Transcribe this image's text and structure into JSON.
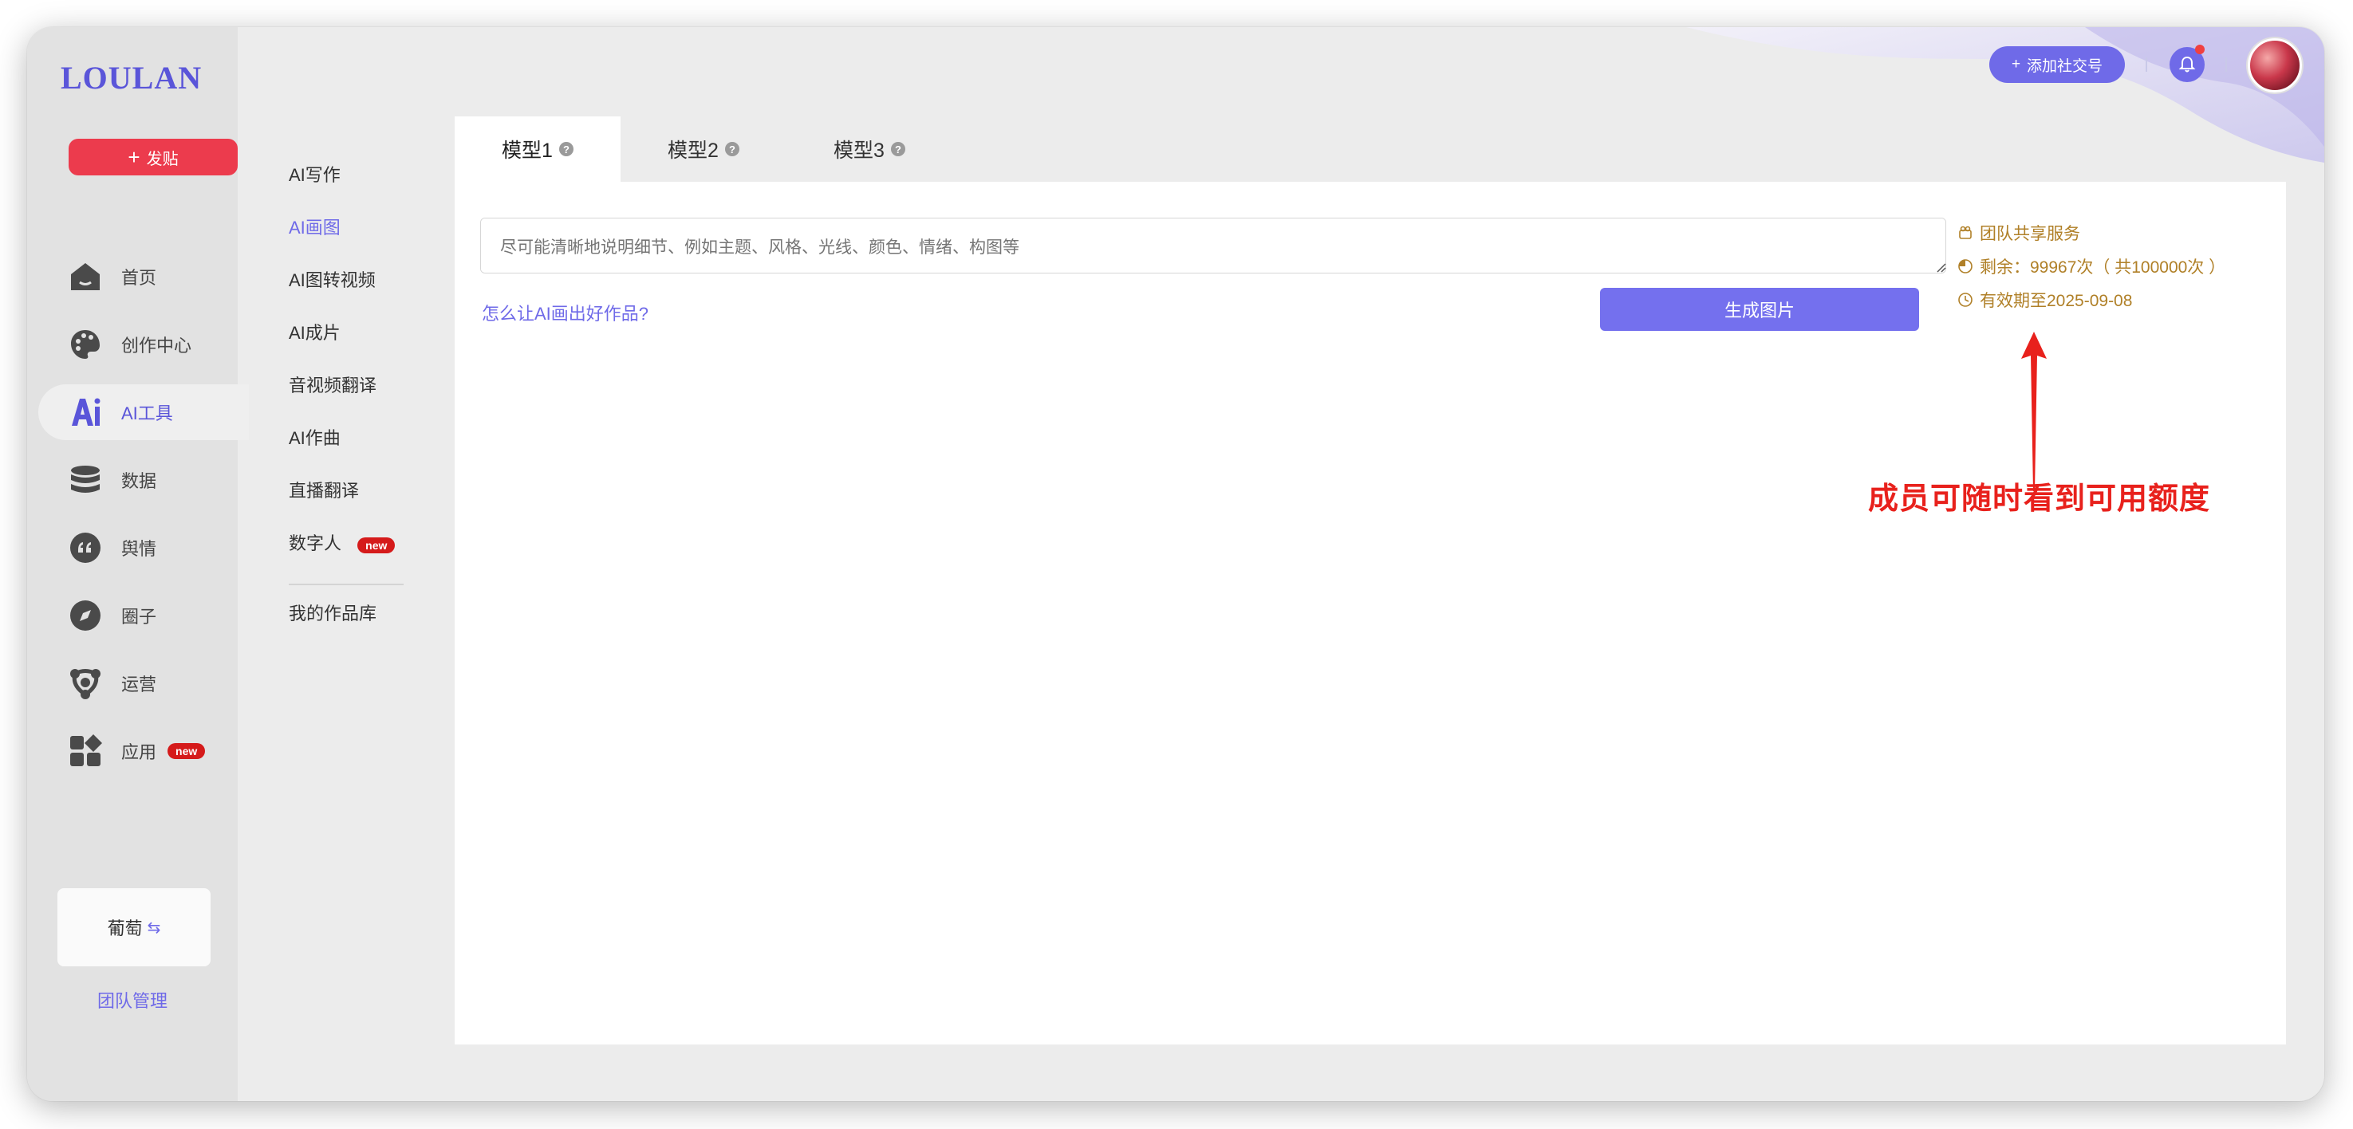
{
  "brand": {
    "logo": "LOULAN",
    "accent": "#6f6ae8",
    "post_color": "#ec3b4d"
  },
  "sidebar": {
    "post_button": "发贴",
    "items": [
      {
        "label": "首页",
        "icon": "home-icon",
        "active": false
      },
      {
        "label": "创作中心",
        "icon": "palette-icon",
        "active": false
      },
      {
        "label": "AI工具",
        "icon": "ai-icon",
        "active": true
      },
      {
        "label": "数据",
        "icon": "database-icon",
        "active": false
      },
      {
        "label": "舆情",
        "icon": "quote-icon",
        "active": false
      },
      {
        "label": "圈子",
        "icon": "compass-icon",
        "active": false
      },
      {
        "label": "运营",
        "icon": "network-icon",
        "active": false
      },
      {
        "label": "应用",
        "icon": "apps-icon",
        "active": false,
        "badge": "new"
      }
    ],
    "team_name": "葡萄",
    "team_manage": "团队管理"
  },
  "submenu": {
    "items": [
      {
        "label": "AI写作",
        "active": false
      },
      {
        "label": "AI画图",
        "active": true
      },
      {
        "label": "AI图转视频",
        "active": false
      },
      {
        "label": "AI成片",
        "active": false
      },
      {
        "label": "音视频翻译",
        "active": false
      },
      {
        "label": "AI作曲",
        "active": false
      },
      {
        "label": "直播翻译",
        "active": false
      },
      {
        "label": "数字人",
        "active": false,
        "badge": "new"
      }
    ],
    "library": "我的作品库"
  },
  "topbar": {
    "add_social": "添加社交号"
  },
  "content": {
    "tabs": [
      {
        "label": "模型1",
        "active": true
      },
      {
        "label": "模型2",
        "active": false
      },
      {
        "label": "模型3",
        "active": false
      }
    ],
    "prompt_placeholder": "尽可能清晰地说明细节、例如主题、风格、光线、颜色、情绪、构图等",
    "help_link": "怎么让AI画出好作品?",
    "generate_button": "生成图片",
    "info": {
      "service": "团队共享服务",
      "remaining": "剩余：99967次（ 共100000次 ）",
      "expiry": "有效期至2025-09-08"
    }
  },
  "annotation": {
    "text": "成员可随时看到可用额度",
    "color": "#e8211c"
  }
}
